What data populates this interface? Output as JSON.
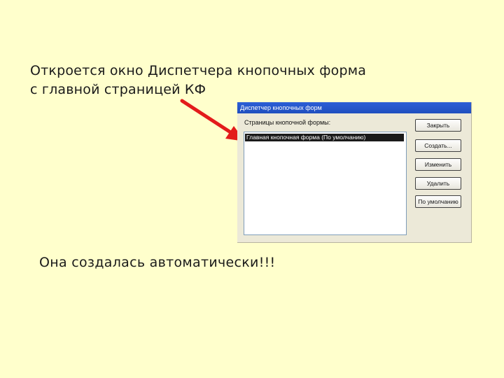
{
  "headline": {
    "line1": "Откроется окно Диспетчера кнопочных форма",
    "line2": "с главной страницей КФ"
  },
  "dialog": {
    "title": "Диспетчер кнопочных форм",
    "list_label": "Страницы кнопочной формы:",
    "list_items": [
      "Главная кнопочная форма (По умолчанию)"
    ],
    "buttons": {
      "close": "Закрыть",
      "create": "Создать...",
      "edit": "Изменить",
      "delete": "Удалить",
      "default": "По умолчанию"
    }
  },
  "footer": "Она создалась автоматически!!!",
  "colors": {
    "background": "#ffffcc",
    "arrow": "#e31b1b",
    "titlebar": "#2c5fd6",
    "selection": "#1a1a1a"
  },
  "icons": {
    "pointer": "red-arrow-icon"
  }
}
